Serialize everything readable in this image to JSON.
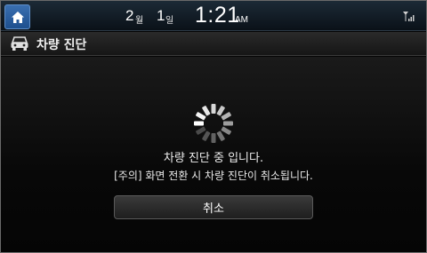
{
  "statusbar": {
    "month": "2",
    "month_unit": "월",
    "day": "1",
    "day_unit": "일",
    "time": "1:21",
    "ampm": "AM",
    "home_icon": "home-icon",
    "signal_icon": "signal-icon"
  },
  "titlebar": {
    "icon": "car-diagnosis-icon",
    "title": "차량 진단"
  },
  "content": {
    "spinner_icon": "loading-spinner-icon",
    "message": "차량 진단 중 입니다.",
    "warning": "[주의] 화면 전환 시 차량 진단이 취소됩니다.",
    "cancel_label": "취소"
  },
  "colors": {
    "home_button": "#2a5fa0",
    "background": "#050505",
    "text": "#eeeeee"
  }
}
